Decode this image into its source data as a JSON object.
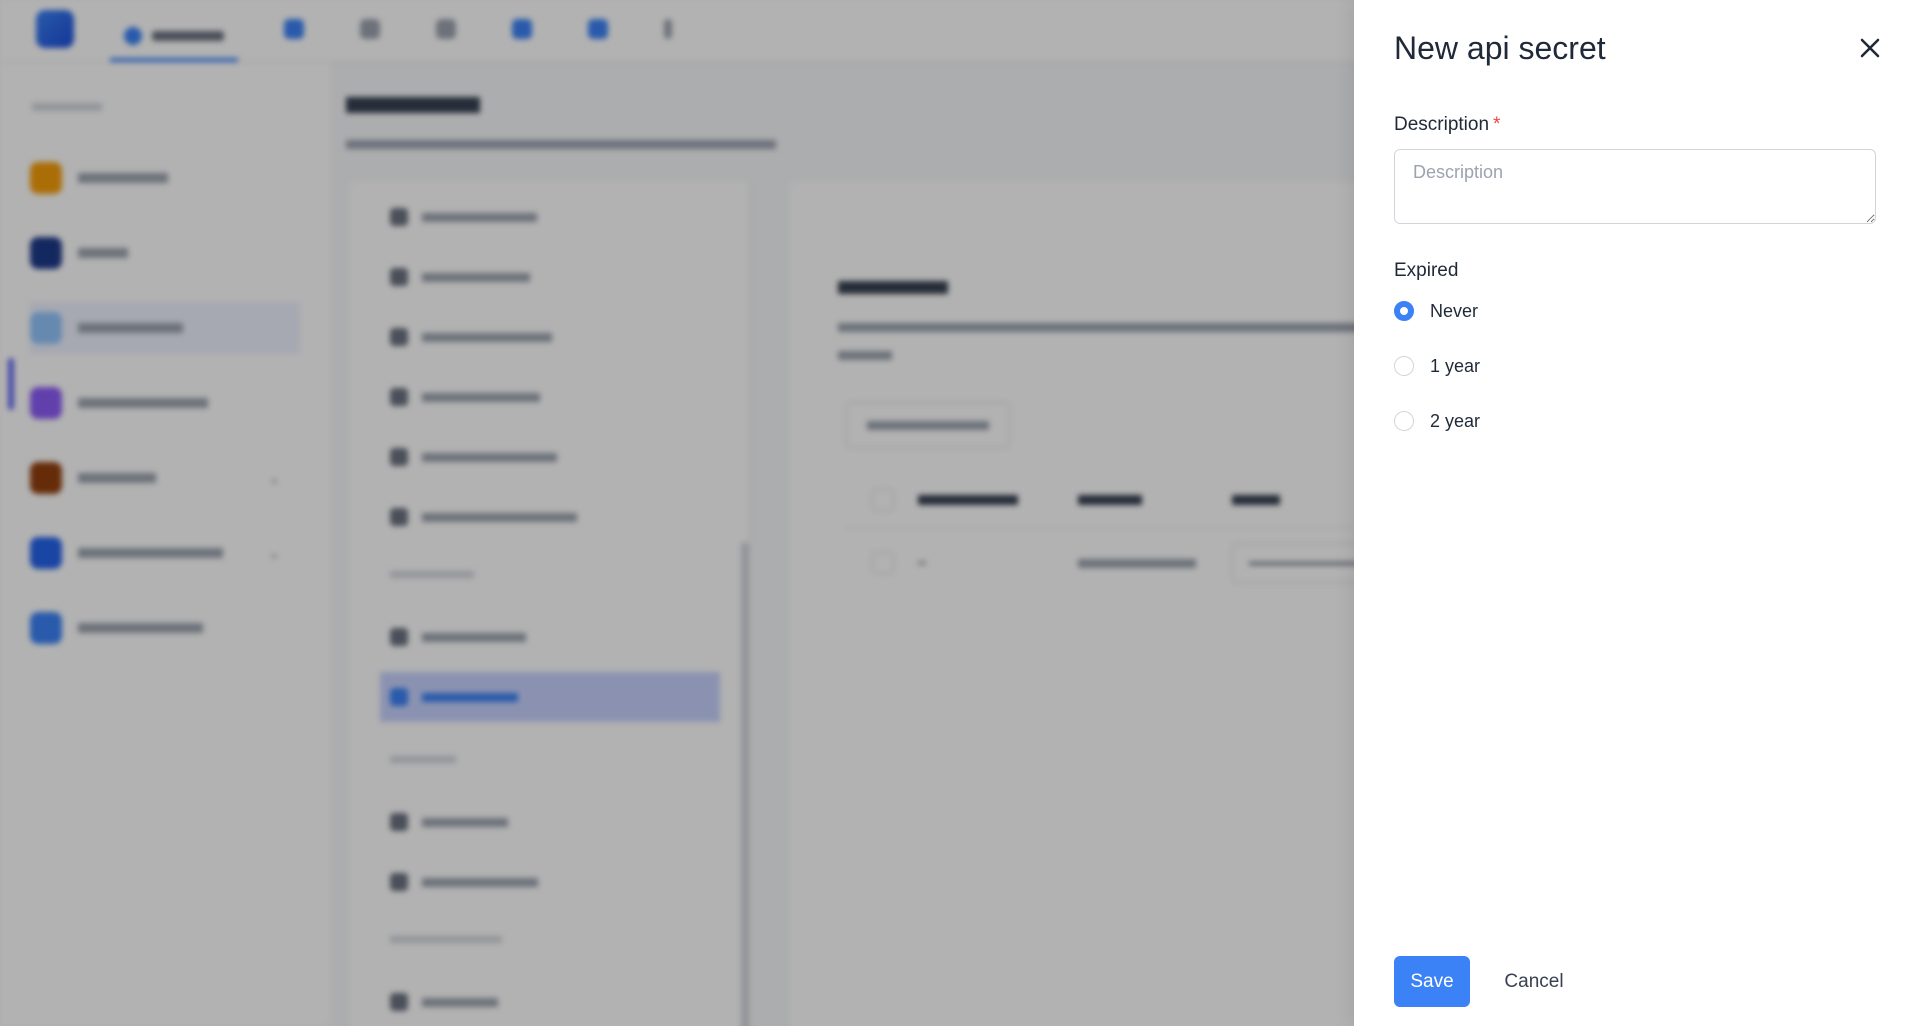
{
  "drawer": {
    "title": "New api secret",
    "close_icon": "close-icon",
    "description": {
      "label": "Description",
      "required_mark": "*",
      "placeholder": "Description",
      "value": ""
    },
    "expired": {
      "label": "Expired",
      "options": [
        {
          "label": "Never",
          "selected": true
        },
        {
          "label": "1 year",
          "selected": false
        },
        {
          "label": "2 year",
          "selected": false
        }
      ]
    },
    "save_label": "Save",
    "cancel_label": "Cancel"
  },
  "colors": {
    "accent": "#3b82f6",
    "required": "#ef4444",
    "overlay": "rgba(0,0,0,0.3)"
  }
}
